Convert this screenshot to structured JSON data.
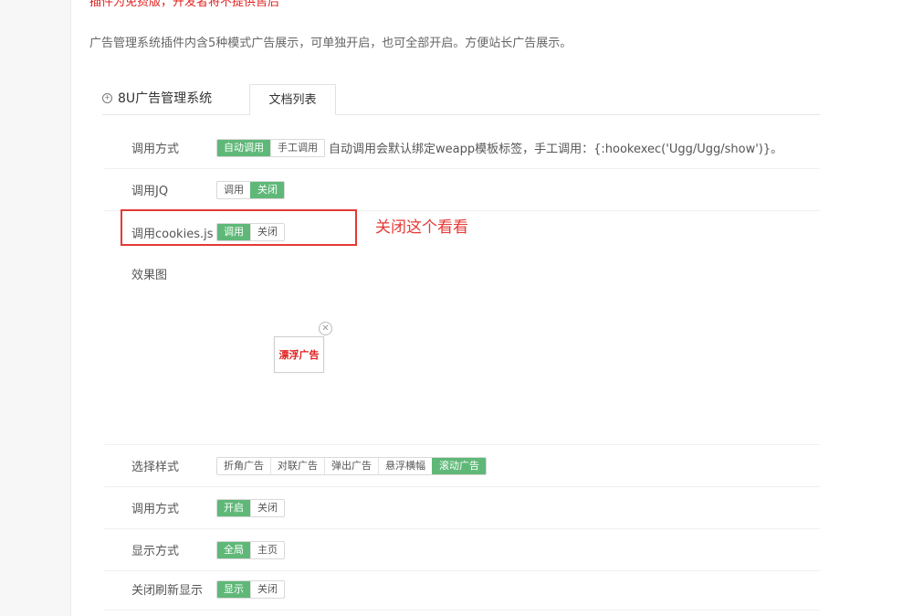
{
  "warning_text": "插件为免费版，开发者将不提供售后",
  "intro_text": "广告管理系统插件内含5种模式广告展示，可单独开启，也可全部开启。方便站长广告展示。",
  "plugin": {
    "title": "8U广告管理系统",
    "tab_label": "文档列表"
  },
  "rows": {
    "call_mode": {
      "label": "调用方式",
      "options": [
        "自动调用",
        "手工调用"
      ],
      "selected": "自动调用",
      "note": "自动调用会默认绑定weapp模板标签，手工调用：{:hookexec('Ugg/Ugg/show')}。"
    },
    "jq": {
      "label": "调用JQ",
      "options": [
        "调用",
        "关闭"
      ],
      "selected": "关闭"
    },
    "cookies": {
      "label": "调用cookies.js",
      "options": [
        "调用",
        "关闭"
      ],
      "selected": "调用"
    },
    "effect": {
      "label": "效果图",
      "ad_text": "漂浮广告",
      "close_icon": "circle-x-icon"
    },
    "style": {
      "label": "选择样式",
      "options": [
        "折角广告",
        "对联广告",
        "弹出广告",
        "悬浮横幅",
        "滚动广告"
      ],
      "selected": "滚动广告"
    },
    "call_switch": {
      "label": "调用方式",
      "options": [
        "开启",
        "关闭"
      ],
      "selected": "开启"
    },
    "display_mode": {
      "label": "显示方式",
      "options": [
        "全局",
        "主页"
      ],
      "selected": "全局"
    },
    "refresh_show": {
      "label": "关闭刷新显示",
      "options": [
        "显示",
        "关闭"
      ],
      "selected": "显示"
    }
  },
  "annotation": {
    "text": "关闭这个看看",
    "color": "#e53935"
  },
  "colors": {
    "accent": "#5fb878",
    "warning": "#e02020"
  }
}
